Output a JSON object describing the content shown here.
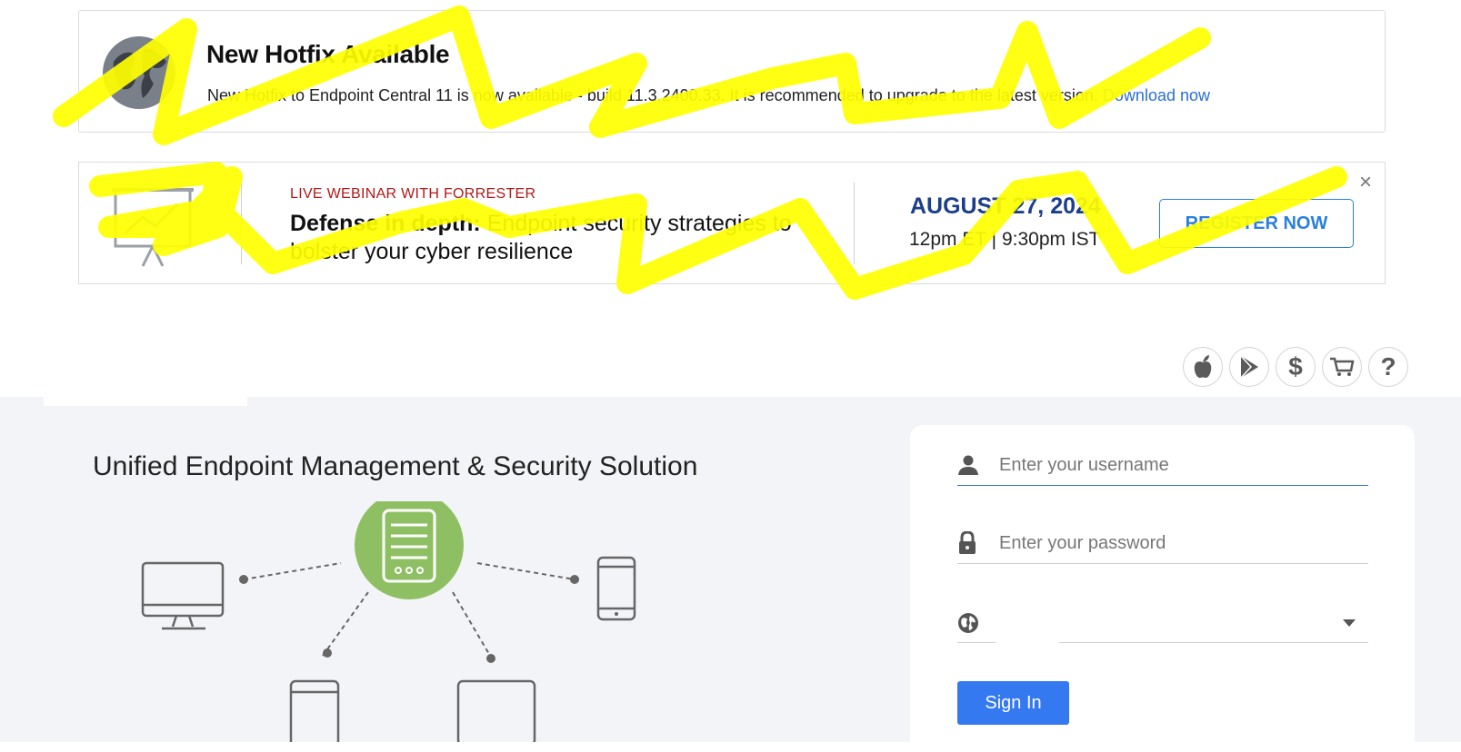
{
  "hotfix": {
    "title": "New Hotfix Available",
    "message": "New Hotfix to Endpoint Central 11 is now available - build 11.3.2400.33. It is recommended to upgrade to the latest version.",
    "link_label": "Download now",
    "icon": "globe-icon"
  },
  "webinar": {
    "eyebrow": "LIVE WEBINAR WITH FORRESTER",
    "title_bold": "Defense in depth:",
    "title_rest": " Endpoint security strategies to bolster your cyber resilience",
    "date": "AUGUST 27, 2024",
    "time": "12pm ET | 9:30pm IST",
    "register_label": "REGISTER NOW",
    "close_label": "×",
    "icon": "presentation-board-icon"
  },
  "app_links": [
    {
      "icon": "apple-icon",
      "glyph": ""
    },
    {
      "icon": "play-store-icon",
      "glyph": ""
    },
    {
      "icon": "dollar-icon",
      "glyph": "$"
    },
    {
      "icon": "cart-icon",
      "glyph": ""
    },
    {
      "icon": "help-icon",
      "glyph": "?"
    }
  ],
  "main": {
    "tagline": "Unified Endpoint Management & Security Solution"
  },
  "login": {
    "username_placeholder": "Enter your username",
    "password_placeholder": "Enter your password",
    "language_value": "",
    "signin_label": "Sign In"
  },
  "colors": {
    "accent": "#3479f0",
    "server": "#8ec063",
    "highlight": "#ffff00",
    "date": "#1b3f8c",
    "eyebrow": "#b01818"
  }
}
